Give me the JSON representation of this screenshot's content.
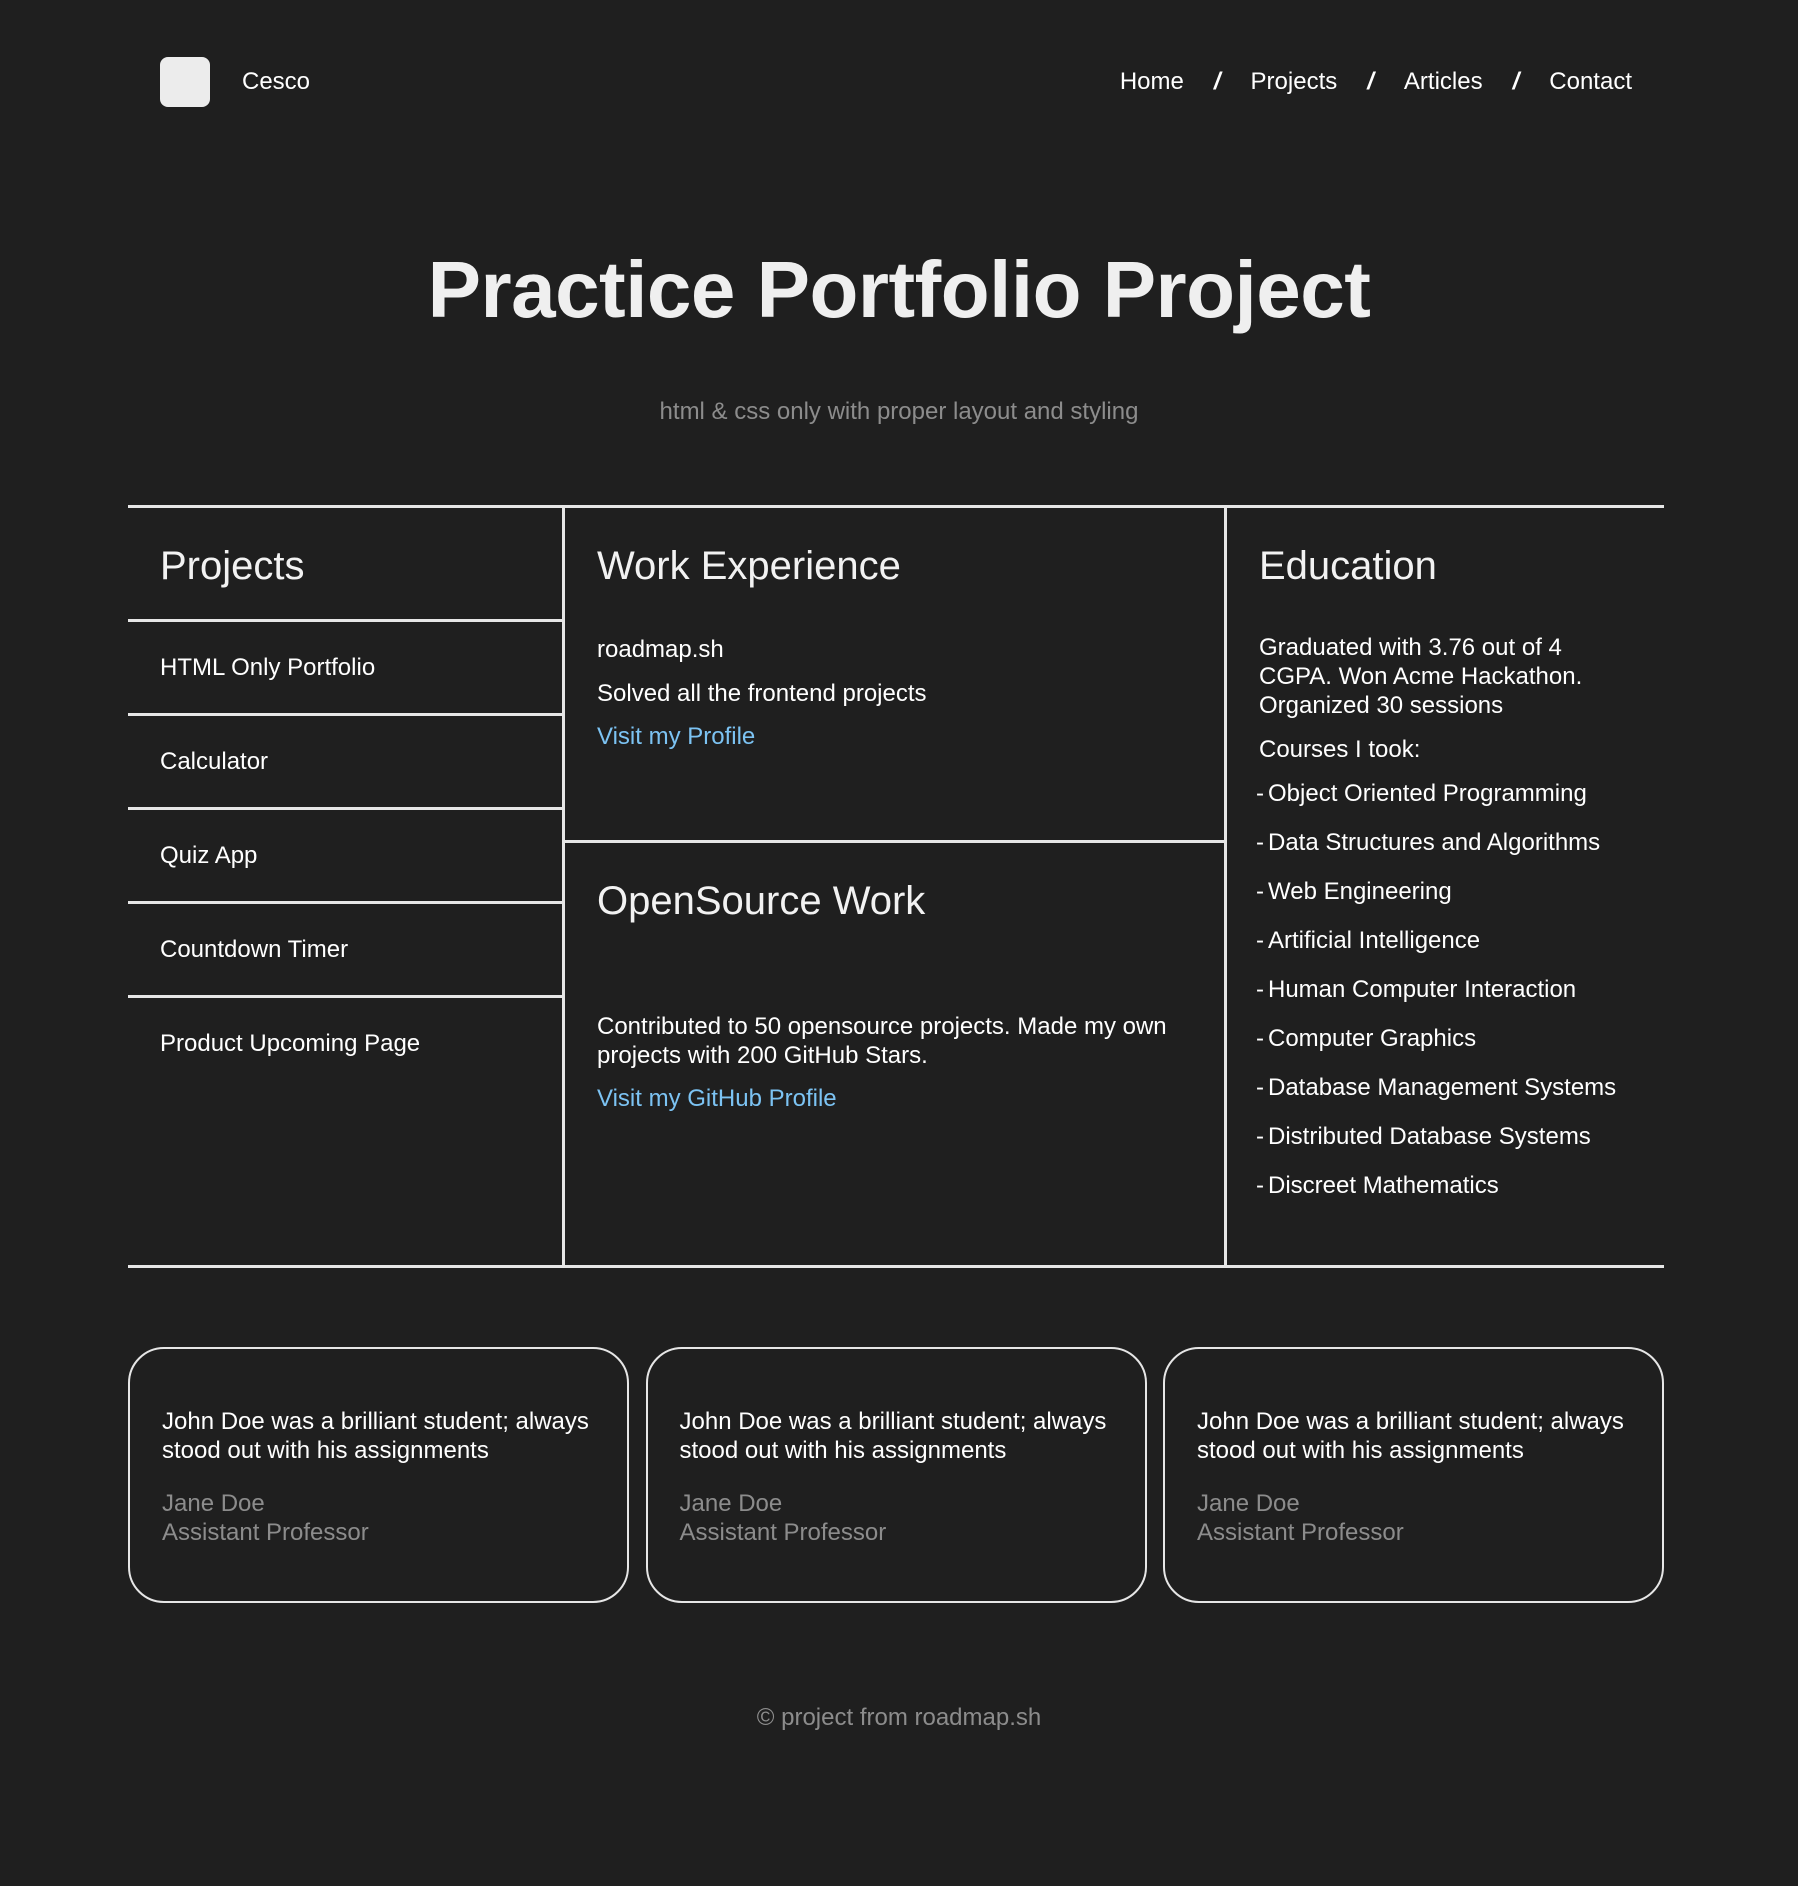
{
  "header": {
    "brand_name": "Cesco",
    "nav": [
      "Home",
      "Projects",
      "Articles",
      "Contact"
    ],
    "separator": "/"
  },
  "hero": {
    "title": "Practice Portfolio Project",
    "subtitle": "html & css only with proper layout and styling"
  },
  "projects": {
    "title": "Projects",
    "items": [
      "HTML Only Portfolio",
      "Calculator",
      "Quiz App",
      "Countdown Timer",
      "Product Upcoming Page"
    ]
  },
  "work": {
    "title": "Work Experience",
    "company": "roadmap.sh",
    "description": "Solved all the frontend projects",
    "link_label": "Visit my Profile"
  },
  "opensource": {
    "title": "OpenSource Work",
    "description": "Contributed to 50 opensource projects. Made my own projects with 200 GitHub Stars.",
    "link_label": "Visit my GitHub Profile"
  },
  "education": {
    "title": "Education",
    "summary": "Graduated with 3.76 out of 4 CGPA. Won Acme Hackathon. Organized 30 sessions",
    "courses_label": "Courses I took:",
    "courses": [
      "Object Oriented Programming",
      "Data Structures and Algorithms",
      "Web Engineering",
      "Artificial Intelligence",
      "Human Computer Interaction",
      "Computer Graphics",
      "Database Management Systems",
      "Distributed Database Systems",
      "Discreet Mathematics"
    ]
  },
  "testimonials": [
    {
      "quote": "John Doe was a brilliant student; always stood out with his assignments",
      "name": "Jane Doe",
      "role": "Assistant Professor"
    },
    {
      "quote": "John Doe was a brilliant student; always stood out with his assignments",
      "name": "Jane Doe",
      "role": "Assistant Professor"
    },
    {
      "quote": "John Doe was a brilliant student; always stood out with his assignments",
      "name": "Jane Doe",
      "role": "Assistant Professor"
    }
  ],
  "footer": {
    "text": "© project from roadmap.sh"
  },
  "colors": {
    "background": "#1f1f1f",
    "text": "#ffffff",
    "muted": "#8c8c8c",
    "link": "#7cc3f3",
    "border": "#e6e6e6"
  }
}
